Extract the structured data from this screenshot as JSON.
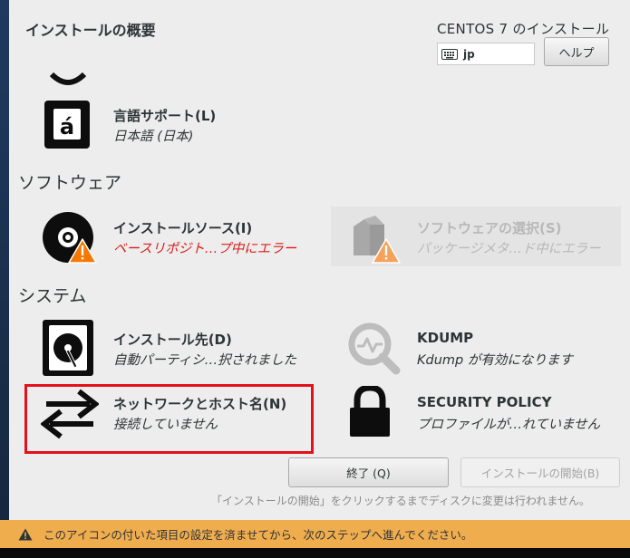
{
  "header": {
    "title": "インストールの概要",
    "product": "CENTOS 7 のインストール",
    "keyboard_layout": "jp",
    "help_label": "ヘルプ"
  },
  "sections": {
    "software": "ソフトウェア",
    "system": "システム"
  },
  "spokes": {
    "language": {
      "title": "言語サポート(L)",
      "status": "日本語 (日本)",
      "icon": "language-icon"
    },
    "install_source": {
      "title": "インストールソース(I)",
      "status": "ベースリポジト…プ中にエラー",
      "icon": "disc-icon"
    },
    "software_selection": {
      "title": "ソフトウェアの選択(S)",
      "status": "パッケージメタ…ド中にエラー",
      "icon": "package-icon"
    },
    "install_dest": {
      "title": "インストール先(D)",
      "status": "自動パーティシ…択されました",
      "icon": "harddisk-icon"
    },
    "kdump": {
      "title": "KDUMP",
      "status": "Kdump が有効になります",
      "icon": "search-icon"
    },
    "network": {
      "title": "ネットワークとホスト名(N)",
      "status": "接続していません",
      "icon": "network-arrows-icon"
    },
    "security": {
      "title": "SECURITY POLICY",
      "status": "プロファイルが…れていません",
      "icon": "lock-icon"
    }
  },
  "buttons": {
    "quit": "終了 (Q)",
    "begin": "インストールの開始(B)"
  },
  "footnote": "「インストールの開始」をクリックするまでディスクに変更は行われません。",
  "warning": "このアイコンの付いた項目の設定を済ませてから、次のステップへ進んでください。",
  "colors": {
    "error": "#d91e18",
    "warning_bar": "#f0ad4e",
    "highlight": "#e4101b"
  }
}
